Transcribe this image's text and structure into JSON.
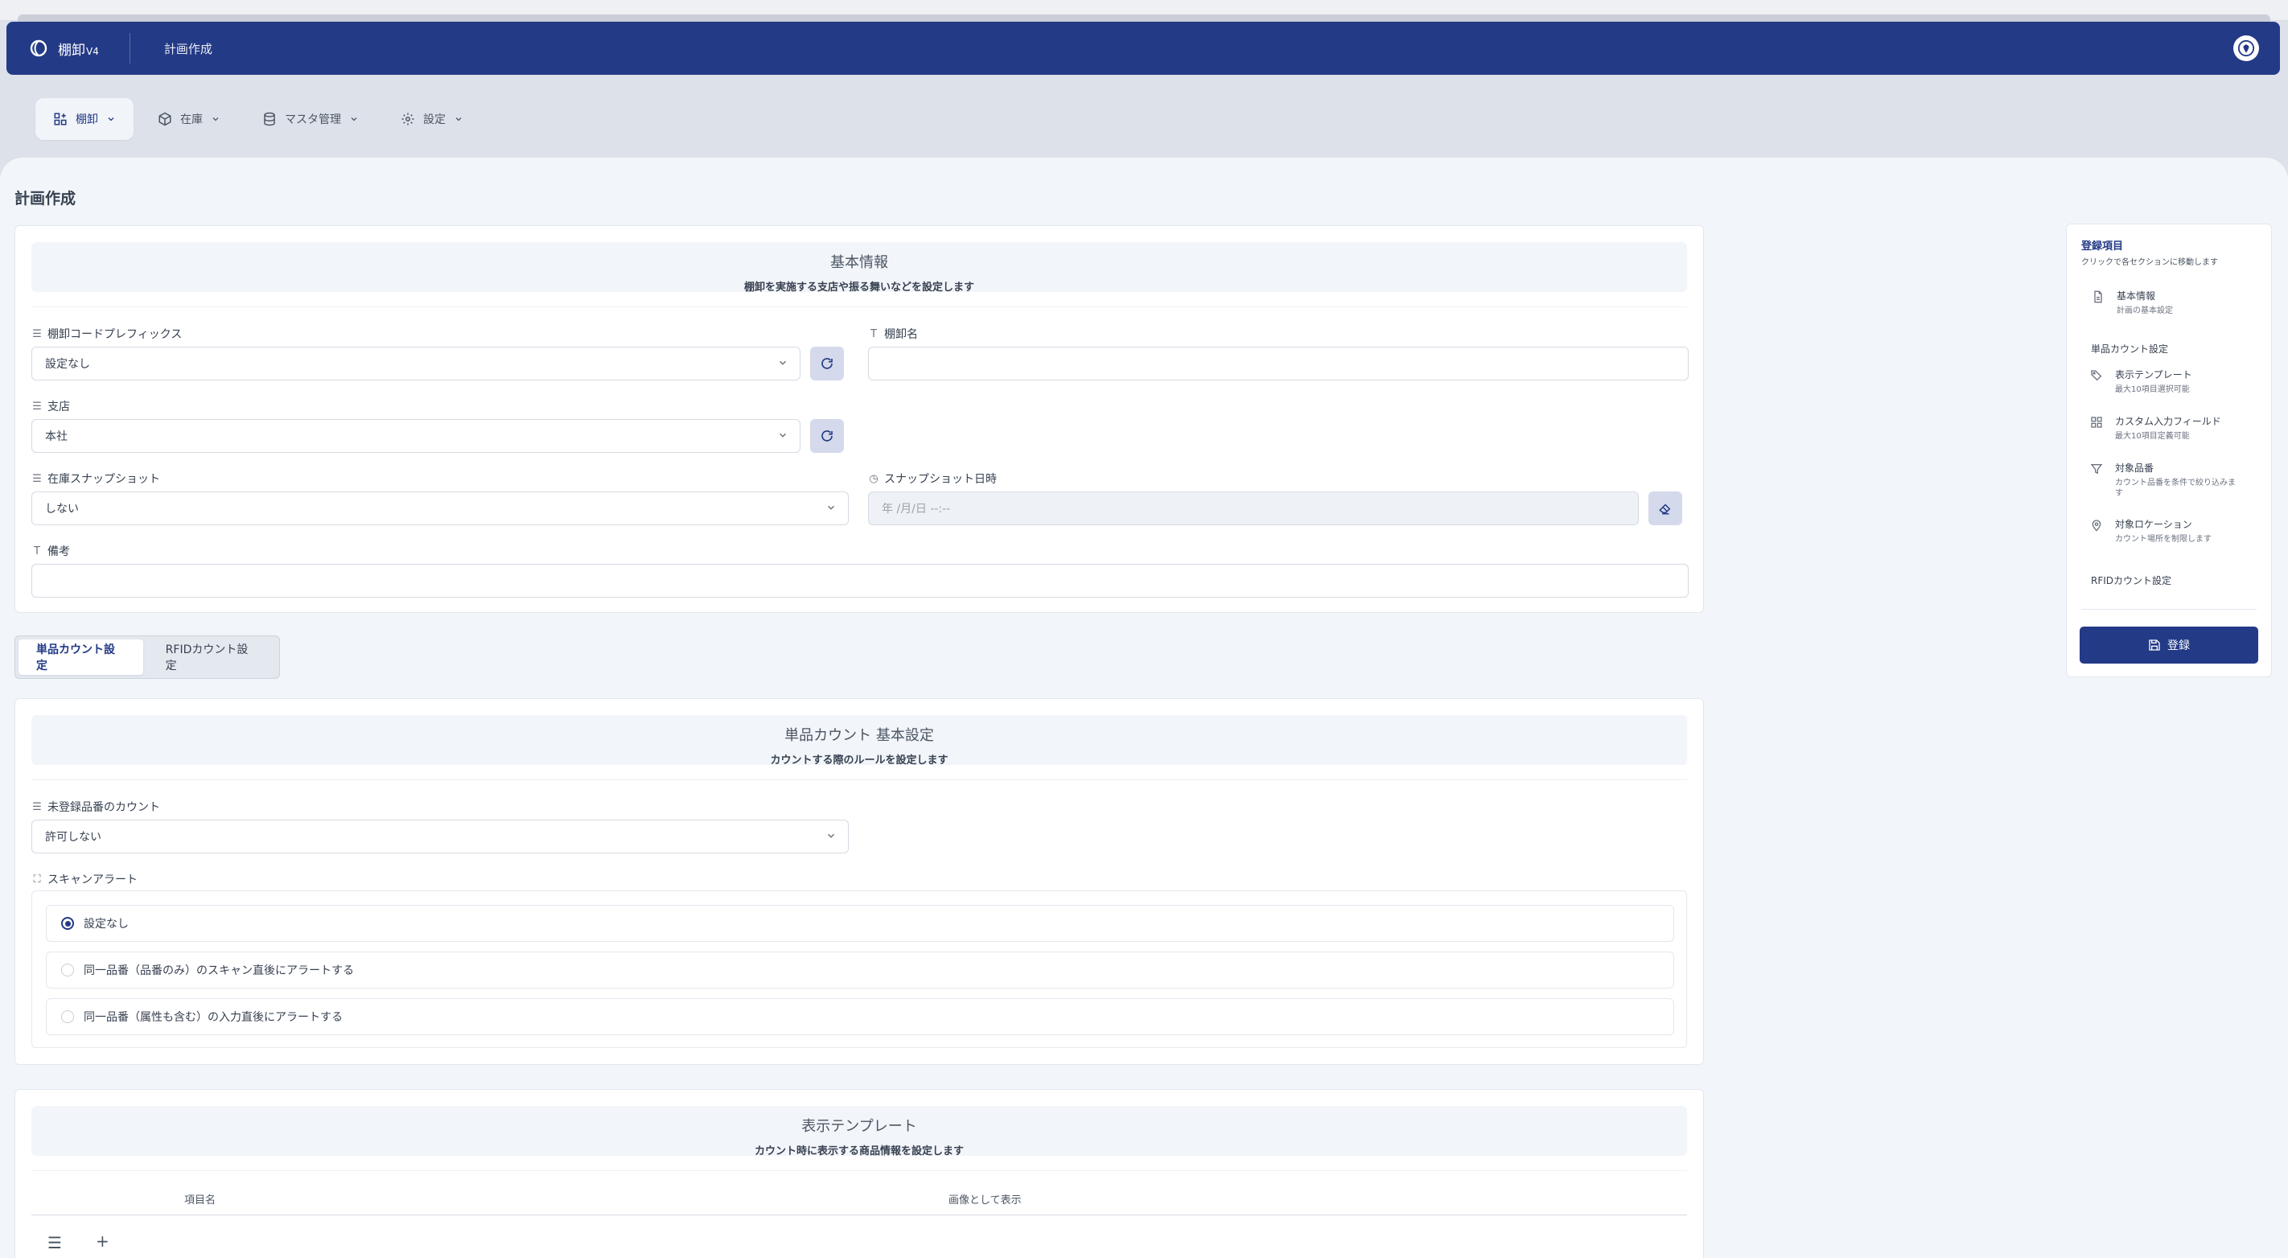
{
  "app": {
    "name": "棚卸",
    "version": "V4",
    "page": "計画作成"
  },
  "nav": [
    {
      "label": "棚卸",
      "icon": "grid-plus-icon"
    },
    {
      "label": "在庫",
      "icon": "box-icon"
    },
    {
      "label": "マスタ管理",
      "icon": "database-icon"
    },
    {
      "label": "設定",
      "icon": "gear-icon"
    }
  ],
  "page_title": "計画作成",
  "basic": {
    "title": "基本情報",
    "subtitle": "棚卸を実施する支店や振る舞いなどを設定します",
    "prefix_label": "棚卸コードプレフィックス",
    "prefix_value": "設定なし",
    "name_label": "棚卸名",
    "name_value": "",
    "branch_label": "支店",
    "branch_value": "本社",
    "snapshot_label": "在庫スナップショット",
    "snapshot_value": "しない",
    "snapshot_date_label": "スナップショット日時",
    "snapshot_date_placeholder": "年 /月/日 --:--",
    "memo_label": "備考",
    "memo_value": ""
  },
  "tabs": [
    {
      "label": "単品カウント設定",
      "active": true
    },
    {
      "label": "RFIDカウント設定",
      "active": false
    }
  ],
  "single": {
    "title": "単品カウント 基本設定",
    "subtitle": "カウントする際のルールを設定します",
    "unregistered_label": "未登録品番のカウント",
    "unregistered_value": "許可しない",
    "scan_alert_label": "スキャンアラート",
    "options": [
      {
        "label": "設定なし",
        "checked": true
      },
      {
        "label": "同一品番（品番のみ）のスキャン直後にアラートする",
        "checked": false
      },
      {
        "label": "同一品番（属性も含む）の入力直後にアラートする",
        "checked": false
      }
    ]
  },
  "template": {
    "title": "表示テンプレート",
    "subtitle": "カウント時に表示する商品情報を設定します",
    "col_name": "項目名",
    "col_image": "画像として表示",
    "add": "+"
  },
  "side": {
    "title": "登録項目",
    "subtitle": "クリックで各セクションに移動します",
    "basic": {
      "label": "基本情報",
      "desc": "計画の基本設定"
    },
    "group_single": "単品カウント設定",
    "items": [
      {
        "label": "表示テンプレート",
        "desc": "最大10項目選択可能"
      },
      {
        "label": "カスタム入力フィールド",
        "desc": "最大10項目定義可能"
      },
      {
        "label": "対象品番",
        "desc": "カウント品番を条件で絞り込みます"
      },
      {
        "label": "対象ロケーション",
        "desc": "カウント場所を制限します"
      }
    ],
    "group_rfid": "RFIDカウント設定",
    "register": "登録"
  },
  "colors": {
    "primary": "#233a86",
    "background": "#f2f5f9"
  }
}
